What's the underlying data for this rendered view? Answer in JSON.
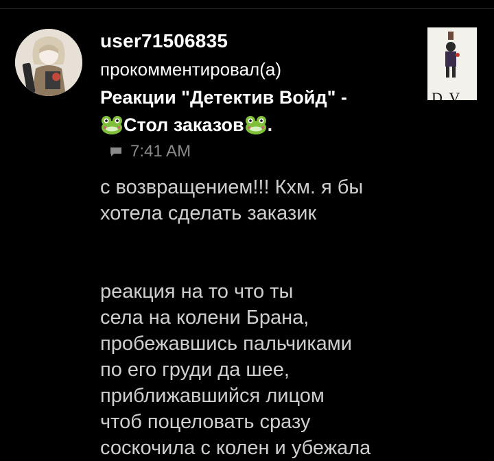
{
  "comment": {
    "username": "user71506835",
    "action": "прокомментировал(а)",
    "post_title_line1": "Реакции \"Детектив Войд\" -",
    "post_title_text": "Стол заказов",
    "post_title_trailing": ".",
    "time": "7:41 AM",
    "body": "с возвращением!!! Кхм. я бы\nхотела сделать заказик\n\n\nреакция  на то что ты\nсела на колени Брана,\nпробежавшись пальчиками\nпо его груди да шее,\nприближавшийся лицом\nчтоб поцеловать сразу\nсоскочила с колен и убежала"
  },
  "thumbnail": {
    "label": "D.V."
  },
  "icons": {
    "avatar": "anime-girl-with-guitar-avatar",
    "frog": "frog-emoji",
    "comment": "comment-bubble-icon"
  },
  "colors": {
    "background": "#000000",
    "text": "#ffffff",
    "body_text": "#cfcfcf",
    "meta": "#8a8a8a"
  }
}
